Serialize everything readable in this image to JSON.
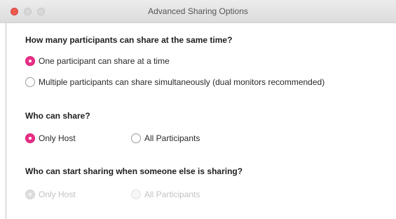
{
  "window": {
    "title": "Advanced Sharing Options"
  },
  "sections": [
    {
      "title": "How many participants can share at the same time?",
      "options": [
        {
          "label": "One participant can share at a time",
          "checked": true,
          "enabled": true
        },
        {
          "label": "Multiple participants can share simultaneously (dual monitors recommended)",
          "checked": false,
          "enabled": true
        }
      ]
    },
    {
      "title": "Who can share?",
      "options": [
        {
          "label": "Only Host",
          "checked": true,
          "enabled": true
        },
        {
          "label": "All Participants",
          "checked": false,
          "enabled": true
        }
      ]
    },
    {
      "title": "Who can start sharing when someone else is sharing?",
      "options": [
        {
          "label": "Only Host",
          "checked": true,
          "enabled": false
        },
        {
          "label": "All Participants",
          "checked": false,
          "enabled": false
        }
      ]
    }
  ],
  "colors": {
    "accent": "#ea2f87",
    "close_button": "#ee5a52",
    "disabled_text": "#c3c3c3"
  }
}
